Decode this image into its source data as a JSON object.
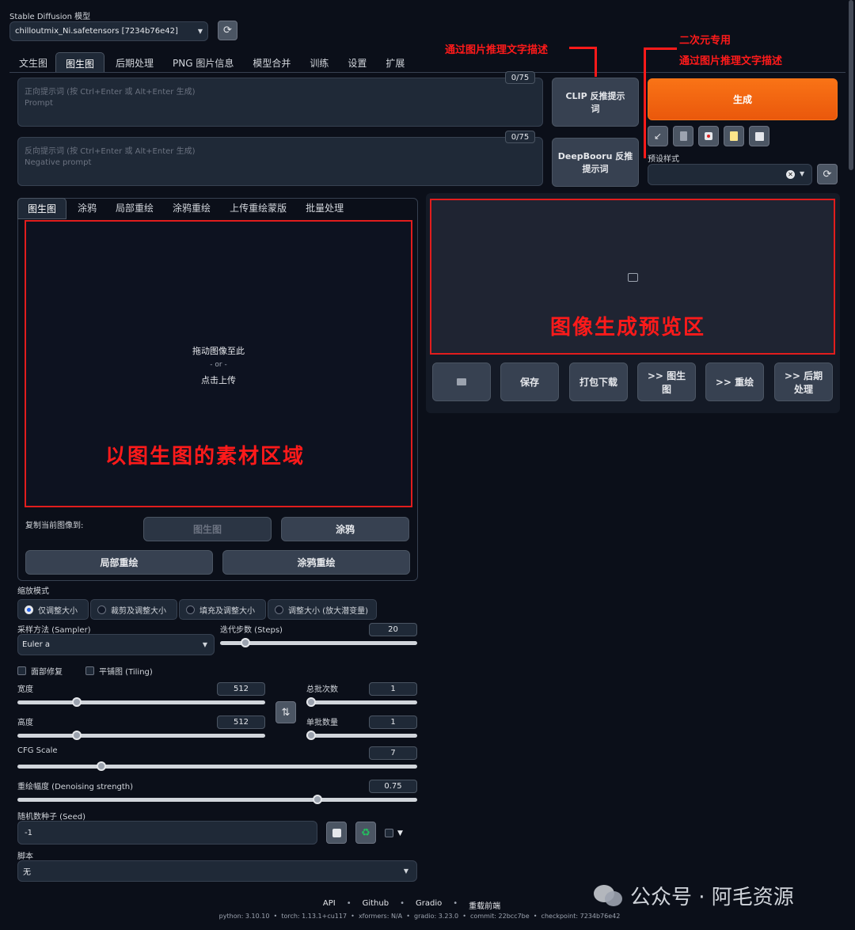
{
  "model": {
    "label": "Stable Diffusion 模型",
    "value": "chilloutmix_Ni.safetensors [7234b76e42]"
  },
  "tabs": [
    "文生图",
    "图生图",
    "后期处理",
    "PNG 图片信息",
    "模型合并",
    "训练",
    "设置",
    "扩展"
  ],
  "prompt": {
    "placeholder_cn": "正向提示词 (按 Ctrl+Enter 或 Alt+Enter 生成)",
    "placeholder_en": "Prompt",
    "counter": "0/75"
  },
  "negative": {
    "placeholder_cn": "反向提示词 (按 Ctrl+Enter 或 Alt+Enter 生成)",
    "placeholder_en": "Negative prompt",
    "counter": "0/75"
  },
  "buttons": {
    "clip_line1": "CLIP 反推提示",
    "clip_line2": "词",
    "deepbooru_line1": "DeepBooru 反推",
    "deepbooru_line2": "提示词",
    "generate": "生成"
  },
  "preset": {
    "label": "预设样式"
  },
  "subtabs": [
    "图生图",
    "涂鸦",
    "局部重绘",
    "涂鸦重绘",
    "上传重绘蒙版",
    "批量处理"
  ],
  "upload": {
    "drag": "拖动图像至此",
    "or": "- or -",
    "click": "点击上传"
  },
  "copy": {
    "label": "复制当前图像到:",
    "img2img": "图生图",
    "sketch": "涂鸦",
    "inpaint": "局部重绘",
    "inpaint_sketch": "涂鸦重绘"
  },
  "resize": {
    "label": "缩放模式",
    "options": [
      "仅调整大小",
      "裁剪及调整大小",
      "填充及调整大小",
      "调整大小 (放大潜变量)"
    ]
  },
  "sampler": {
    "label": "采样方法 (Sampler)",
    "value": "Euler a"
  },
  "steps": {
    "label": "迭代步数 (Steps)",
    "value": "20",
    "fraction": 0.13
  },
  "checks": {
    "face": "面部修复",
    "tiling": "平铺图 (Tiling)"
  },
  "width": {
    "label": "宽度",
    "value": "512",
    "fraction": 0.24
  },
  "height": {
    "label": "高度",
    "value": "512",
    "fraction": 0.24
  },
  "batch_count": {
    "label": "总批次数",
    "value": "1",
    "fraction": 0.0
  },
  "batch_size": {
    "label": "单批数量",
    "value": "1",
    "fraction": 0.0
  },
  "cfg": {
    "label": "CFG Scale",
    "value": "7",
    "fraction": 0.21
  },
  "denoise": {
    "label": "重绘幅度 (Denoising strength)",
    "value": "0.75",
    "fraction": 0.75
  },
  "seed": {
    "label": "随机数种子 (Seed)",
    "value": "-1"
  },
  "script": {
    "label": "脚本",
    "value": "无"
  },
  "output_buttons": {
    "save": "保存",
    "zip": "打包下载",
    "to_img2img_1": ">> 图生",
    "to_img2img_2": "图",
    "to_inpaint": ">> 重绘",
    "to_extras_1": ">> 后期",
    "to_extras_2": "处理"
  },
  "annotations": {
    "clip": "通过图片推理文字描述",
    "anime_1": "二次元专用",
    "anime_2": "通过图片推理文字描述",
    "preview": "图像生成预览区",
    "material": "以图生图的素材区域"
  },
  "footer": {
    "links": [
      "API",
      "Github",
      "Gradio",
      "重载前端"
    ],
    "info": "python: 3.10.10  •  torch: 1.13.1+cu117  •  xformers: N/A  •  gradio: 3.23.0  •  commit: 22bcc7be  •  checkpoint: 7234b76e42"
  },
  "watermark": "公众号 · 阿毛资源",
  "colors": {
    "accent": "#f97316",
    "annotation": "#ff1a1a",
    "background": "#0b0f19",
    "panel": "#1f2937"
  }
}
